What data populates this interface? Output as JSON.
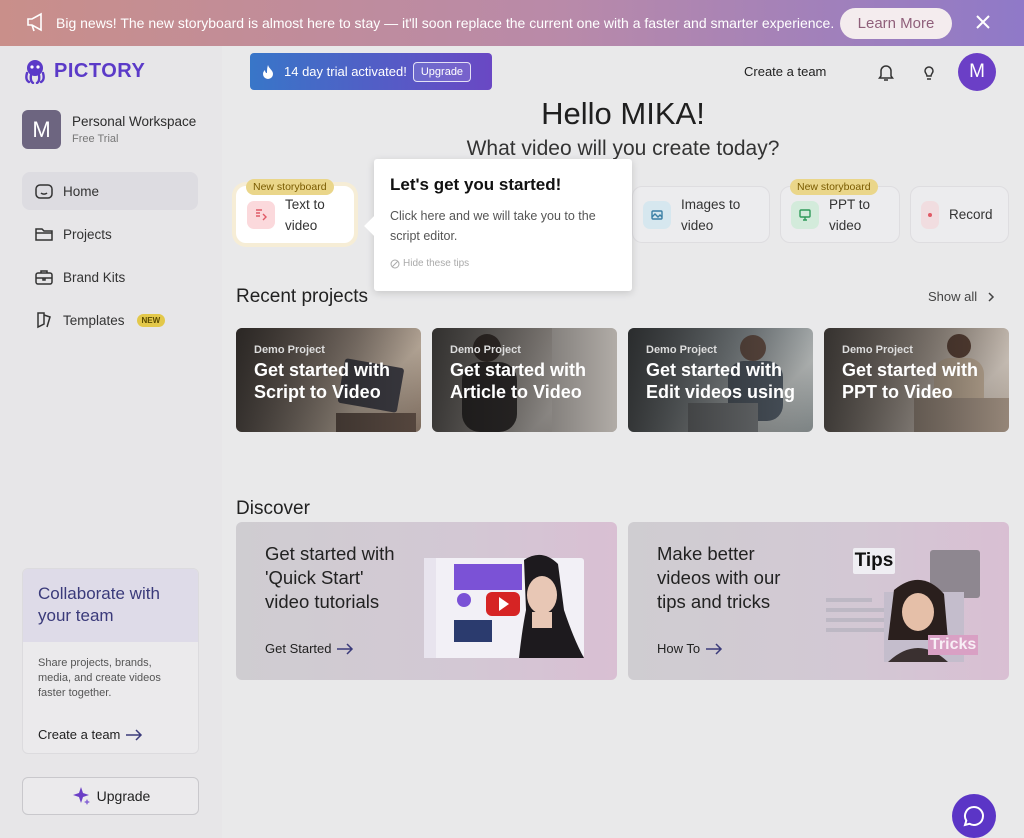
{
  "banner": {
    "message": "Big news! The new storyboard is almost here to stay — it'll soon replace the current one with a faster and smarter experience.",
    "cta": "Learn More"
  },
  "sidebar": {
    "logo": "PICTORY",
    "workspace": {
      "initial": "M",
      "name": "Personal Workspace",
      "plan": "Free Trial"
    },
    "items": [
      {
        "label": "Home",
        "icon": "home-icon",
        "active": true
      },
      {
        "label": "Projects",
        "icon": "folder-icon"
      },
      {
        "label": "Brand Kits",
        "icon": "briefcase-icon"
      },
      {
        "label": "Templates",
        "icon": "templates-icon",
        "badge": "NEW"
      }
    ],
    "collab": {
      "title": "Collaborate with your team",
      "description": "Share projects, brands, media, and create videos faster together.",
      "cta": "Create a team"
    },
    "upgrade": "Upgrade"
  },
  "topbar": {
    "trial_text": "14 day trial activated!",
    "trial_button": "Upgrade",
    "create_team": "Create a team",
    "user_initial": "M"
  },
  "greeting": {
    "title": "Hello MIKA!",
    "subtitle": "What video will you create today?"
  },
  "quick_actions": [
    {
      "line1": "Text to",
      "line2": "video",
      "badge": "New storyboard",
      "icon": "text-to-video-icon"
    },
    {
      "line1": "Images to",
      "line2": "video",
      "icon": "images-icon"
    },
    {
      "line1": "PPT to",
      "line2": "video",
      "badge": "New storyboard",
      "icon": "ppt-icon"
    },
    {
      "line1": "Record",
      "line2": "",
      "icon": "record-icon"
    }
  ],
  "tooltip": {
    "title": "Let's get you started!",
    "body": "Click here and we will take you to the script editor.",
    "hide": "Hide these tips"
  },
  "recent": {
    "title": "Recent projects",
    "show_all": "Show all",
    "projects": [
      {
        "tag": "Demo Project",
        "title": "Get started with Script to Video"
      },
      {
        "tag": "Demo Project",
        "title": "Get started with Article to Video"
      },
      {
        "tag": "Demo Project",
        "title": "Get started with Edit videos using"
      },
      {
        "tag": "Demo Project",
        "title": "Get started with PPT to Video"
      }
    ]
  },
  "discover": {
    "title": "Discover",
    "cards": [
      {
        "title": "Get started with 'Quick Start' video tutorials",
        "link": "Get Started"
      },
      {
        "title": "Make better videos with our tips and tricks",
        "link": "How To",
        "art_top": "Tips",
        "art_bottom": "Tricks"
      }
    ]
  },
  "colors": {
    "brand": "#5b3ac8",
    "accent": "#6b3fc6",
    "badge": "#e3c84a"
  }
}
